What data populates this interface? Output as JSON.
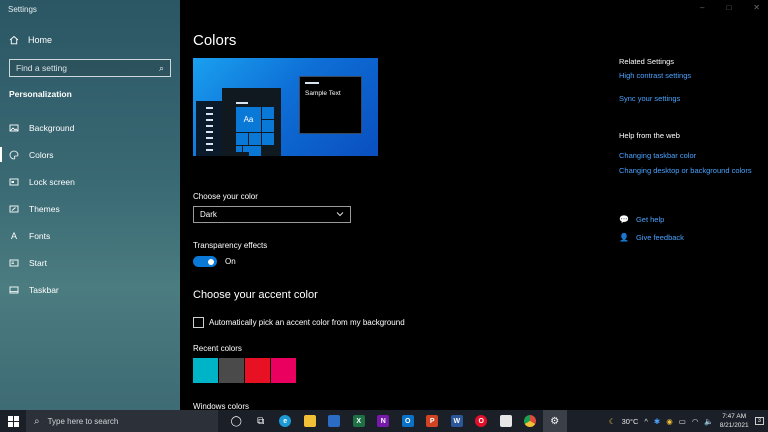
{
  "window": {
    "title": "Settings",
    "controls": [
      "–",
      "□",
      "✕"
    ]
  },
  "sidebar": {
    "home": "Home",
    "search_placeholder": "Find a setting",
    "section": "Personalization",
    "items": [
      {
        "label": "Background",
        "icon": "image-icon"
      },
      {
        "label": "Colors",
        "icon": "palette-icon",
        "active": true
      },
      {
        "label": "Lock screen",
        "icon": "lock-screen-icon"
      },
      {
        "label": "Themes",
        "icon": "brush-icon"
      },
      {
        "label": "Fonts",
        "icon": "font-icon"
      },
      {
        "label": "Start",
        "icon": "start-icon"
      },
      {
        "label": "Taskbar",
        "icon": "taskbar-icon"
      }
    ]
  },
  "main": {
    "title": "Colors",
    "preview": {
      "tile_text": "Aa",
      "sample_text": "Sample Text"
    },
    "choose_color_label": "Choose your color",
    "choose_color_value": "Dark",
    "transparency_label": "Transparency effects",
    "transparency_state": "On",
    "accent_title": "Choose your accent color",
    "auto_accent_label": "Automatically pick an accent color from my background",
    "recent_colors_label": "Recent colors",
    "recent_colors": [
      "#00b4c8",
      "#4a4a4a",
      "#e81123",
      "#ea005e"
    ],
    "windows_colors_label": "Windows colors"
  },
  "related": {
    "title": "Related Settings",
    "links": [
      "High contrast settings",
      "Sync your settings"
    ],
    "help_title": "Help from the web",
    "help_links": [
      "Changing taskbar color",
      "Changing desktop or background colors"
    ],
    "get_help": "Get help",
    "feedback": "Give feedback"
  },
  "taskbar": {
    "search_placeholder": "Type here to search",
    "apps": [
      {
        "name": "task-view-icon",
        "color": "#1a1f28",
        "glyph": "◯"
      },
      {
        "name": "task-switch-icon",
        "color": "#1a1f28",
        "glyph": "⧉"
      },
      {
        "name": "edge-icon",
        "color": "#1c9ad6",
        "glyph": "e"
      },
      {
        "name": "file-explorer-icon",
        "color": "#f2c037",
        "glyph": ""
      },
      {
        "name": "store-icon",
        "color": "#2b6cc4",
        "glyph": ""
      },
      {
        "name": "excel-icon",
        "color": "#1e7145",
        "glyph": "X"
      },
      {
        "name": "onenote-icon",
        "color": "#7719aa",
        "glyph": "N"
      },
      {
        "name": "outlook-icon",
        "color": "#0a72c6",
        "glyph": "O"
      },
      {
        "name": "powerpoint-icon",
        "color": "#d04423",
        "glyph": "P"
      },
      {
        "name": "word-icon",
        "color": "#2b579a",
        "glyph": "W"
      },
      {
        "name": "opera-icon",
        "color": "#e0102a",
        "glyph": "O"
      },
      {
        "name": "notepad-icon",
        "color": "#e6e6e6",
        "glyph": ""
      },
      {
        "name": "chrome-icon",
        "color": "#dd4b39",
        "glyph": ""
      },
      {
        "name": "settings-icon",
        "color": "#3a3f48",
        "glyph": "⚙",
        "active": true
      }
    ],
    "temperature": "30°C",
    "time": "7:47 AM",
    "date": "8/21/2021",
    "notifications": "3"
  },
  "colors": {
    "accent": "#0a78d7",
    "link": "#4aa3ff"
  }
}
